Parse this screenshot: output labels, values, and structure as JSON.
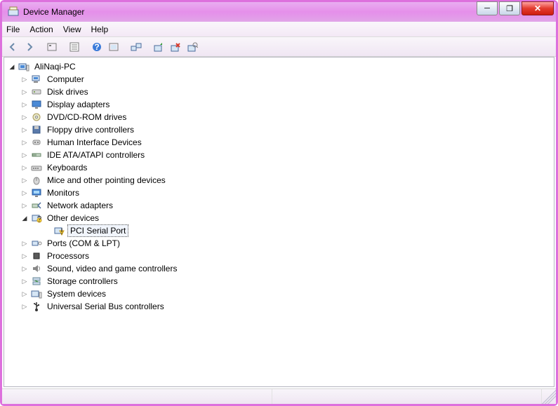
{
  "window": {
    "title": "Device Manager"
  },
  "menu": {
    "file": "File",
    "action": "Action",
    "view": "View",
    "help": "Help"
  },
  "tree": {
    "root": "AliNaqi-PC",
    "categories": [
      {
        "name": "Computer",
        "icon": "computer"
      },
      {
        "name": "Disk drives",
        "icon": "disk"
      },
      {
        "name": "Display adapters",
        "icon": "display"
      },
      {
        "name": "DVD/CD-ROM drives",
        "icon": "dvd"
      },
      {
        "name": "Floppy drive controllers",
        "icon": "floppy"
      },
      {
        "name": "Human Interface Devices",
        "icon": "hid"
      },
      {
        "name": "IDE ATA/ATAPI controllers",
        "icon": "ide"
      },
      {
        "name": "Keyboards",
        "icon": "keyboard"
      },
      {
        "name": "Mice and other pointing devices",
        "icon": "mouse"
      },
      {
        "name": "Monitors",
        "icon": "monitor"
      },
      {
        "name": "Network adapters",
        "icon": "network"
      },
      {
        "name": "Other devices",
        "icon": "other",
        "expanded": true,
        "children": [
          {
            "name": "PCI Serial Port",
            "icon": "warning",
            "selected": true
          }
        ]
      },
      {
        "name": "Ports (COM & LPT)",
        "icon": "port"
      },
      {
        "name": "Processors",
        "icon": "processor"
      },
      {
        "name": "Sound, video and game controllers",
        "icon": "sound"
      },
      {
        "name": "Storage controllers",
        "icon": "storage"
      },
      {
        "name": "System devices",
        "icon": "system"
      },
      {
        "name": "Universal Serial Bus controllers",
        "icon": "usb"
      }
    ]
  },
  "toolbar_icons": [
    "back",
    "forward",
    "|",
    "show-hidden",
    "|",
    "properties",
    "|",
    "help",
    "refresh",
    "|",
    "remote",
    "|",
    "update",
    "uninstall",
    "scan"
  ]
}
